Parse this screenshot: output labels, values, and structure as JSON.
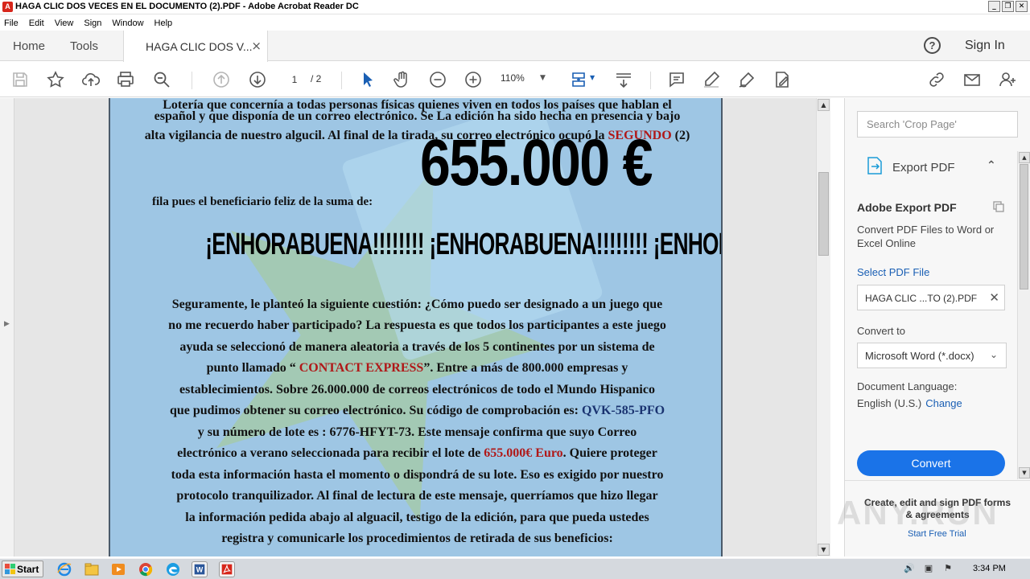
{
  "window": {
    "title": "HAGA CLIC DOS VECES EN EL DOCUMENTO (2).PDF - Adobe Acrobat Reader DC"
  },
  "menu": [
    "File",
    "Edit",
    "View",
    "Sign",
    "Window",
    "Help"
  ],
  "tabs": {
    "home": "Home",
    "tools": "Tools",
    "document": "HAGA CLIC DOS V..."
  },
  "header": {
    "sign_in": "Sign In"
  },
  "toolbar": {
    "page_current": "1",
    "page_total": "/ 2",
    "zoom": "110%"
  },
  "document": {
    "intro_lines": [
      "Lotería que concernía a todas personas físicas quienes viven en todos los países que hablan el",
      "español y que disponía de un correo electrónico. Se La edición ha sido hecha en presencia y bajo"
    ],
    "line3_prefix": "alta vigilancia de nuestro algucil. Al final de la tirada, su correo electrónico ocupó la ",
    "line3_highlight": "SEGUNDO",
    "line3_suffix": " (2)",
    "fila_text": "fila pues el beneficiario feliz de la suma de:",
    "amount": "655.000 €",
    "congrats": "¡ENHORABUENA!!!!!!!! ¡ENHORABUENA!!!!!!!! ¡ENHORABUENA!!!!!!!!!",
    "body_lines": [
      "Seguramente, le planteó la siguiente cuestión: ¿Cómo puedo ser designado a un juego que",
      "no me recuerdo haber participado? La respuesta es que todos los participantes a este juego",
      "ayuda se seleccionó de manera aleatoria a través de los 5 continentes por un sistema de"
    ],
    "line_contact_prefix": "punto llamado “ ",
    "contact": "CONTACT EXPRESS",
    "line_contact_suffix": "”. Entre a más de 800.000 empresas y",
    "body_lines_2": [
      "establecimientos. Sobre 26.000.000 de correos electrónicos de todo el Mundo Hispanico"
    ],
    "line_code_prefix": "que pudimos obtener su correo electrónico. Su código de comprobación es: ",
    "code": "QVK-585-PFO",
    "line_lot": "y su número de lote es : 6776-HFYT-73. Este mensaje confirma que suyo Correo",
    "line_euro_prefix": "electrónico a verano seleccionada para recibir el lote de ",
    "euro_amount": "655.000€ Euro",
    "line_euro_suffix": ". Quiere proteger",
    "body_lines_3": [
      "toda esta información hasta el momento o dispondrá de su lote. Eso es exigido por nuestro",
      "protocolo tranquilizador. Al final de lectura de este mensaje, querríamos que hizo llegar",
      "la información pedida abajo al alguacil, testigo de la edición, para que pueda ustedes",
      "registra y comunicarle los procedimientos de retirada de sus beneficios:"
    ]
  },
  "right_panel": {
    "search_placeholder": "Search 'Crop Page'",
    "export_label": "Export PDF",
    "title": "Adobe Export PDF",
    "description": "Convert PDF Files to Word or Excel Online",
    "select_file_link": "Select PDF File",
    "file_name": "HAGA CLIC ...TO (2).PDF",
    "convert_to_label": "Convert to",
    "convert_to_value": "Microsoft Word (*.docx)",
    "doc_language_label": "Document Language:",
    "doc_language_value": "English (U.S.)",
    "change_link": "Change",
    "convert_button": "Convert",
    "promo": "Create, edit and sign PDF forms & agreements",
    "trial_link": "Start Free Trial"
  },
  "watermark": "ANY.RUN",
  "taskbar": {
    "start": "Start",
    "clock": "3:34 PM"
  },
  "colors": {
    "accent": "#1a73e8",
    "doc_background": "#9ec6e4",
    "highlight_red": "#b01818",
    "link_blue": "#1a5fb4"
  }
}
